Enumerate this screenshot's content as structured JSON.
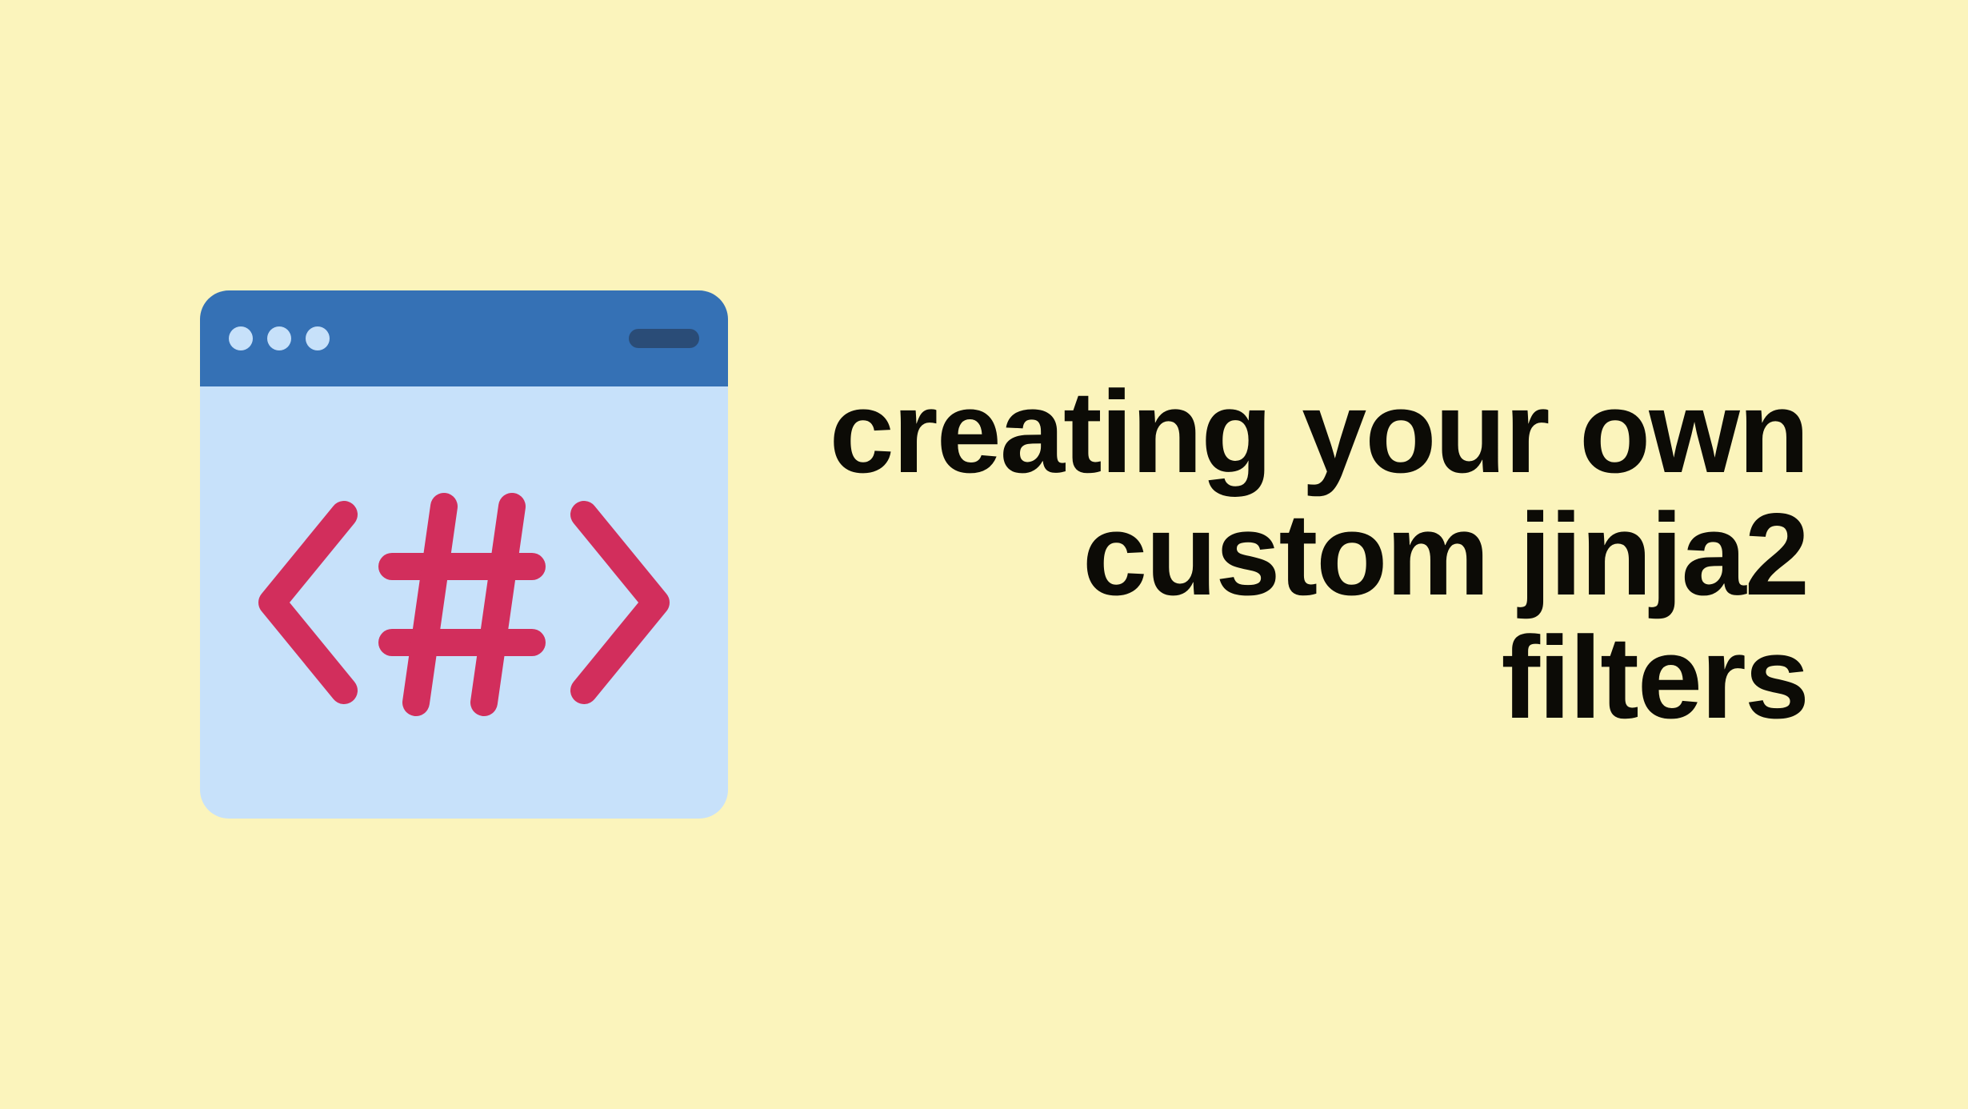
{
  "icon": {
    "name": "code-hash-icon",
    "titlebar_color": "#3571b5",
    "body_color": "#c7e1fa",
    "glyph_color": "#d22e5c",
    "dark_bar_color": "#2a4c77"
  },
  "headline": {
    "text": "creating your own custom jinja2 filters"
  },
  "background_color": "#fbf4bc"
}
